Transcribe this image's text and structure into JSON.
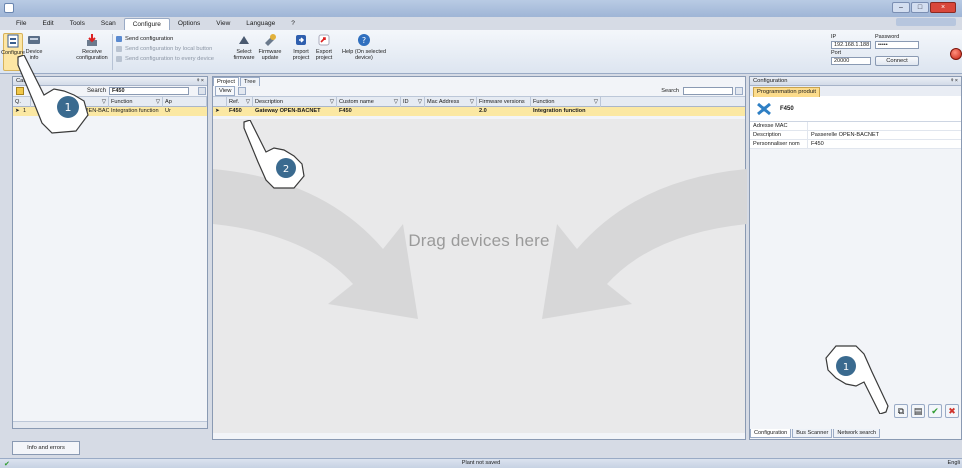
{
  "menu": [
    "File",
    "Edit",
    "Tools",
    "Scan",
    "Configure",
    "Options",
    "View",
    "Language",
    "?"
  ],
  "menu_active_index": 4,
  "ribbon": {
    "buttons": [
      {
        "label": "Configure",
        "icon": "configure-icon"
      },
      {
        "label": "Device info",
        "icon": "device-info-icon"
      },
      {
        "label": "Receive configuration",
        "icon": "receive-config-icon"
      },
      {
        "label": "Select firmware",
        "icon": "select-firmware-icon"
      },
      {
        "label": "Firmware update",
        "icon": "firmware-update-icon"
      },
      {
        "label": "Import project",
        "icon": "import-project-icon"
      },
      {
        "label": "Export project",
        "icon": "export-project-icon"
      },
      {
        "label": "Help (On selected device)",
        "icon": "help-icon"
      }
    ],
    "send": [
      "Send configuration",
      "Send configuration by local button",
      "Send configuration to every device"
    ]
  },
  "connection": {
    "ip_label": "IP",
    "ip": "192.168.1.188",
    "password_label": "Password",
    "password": "•••••",
    "port_label": "Port",
    "port": "20000",
    "connect": "Connect"
  },
  "catalog": {
    "title": "Catal",
    "search_label": "Search",
    "search_value": "F450",
    "columns": [
      "Q.",
      "",
      "cription",
      "Function",
      "Ap"
    ],
    "row": {
      "qty": "1",
      "description": "iteway OPEN-BACNET",
      "function": "Integration function",
      "app": "Ur"
    }
  },
  "info_tab": "Info and errors",
  "project": {
    "tabs": [
      "Project",
      "Tree"
    ],
    "view": "View",
    "search_label": "Search",
    "columns": [
      "Ref.",
      "Description",
      "Custom name",
      "ID",
      "Mac Address",
      "Firmware versions",
      "Function"
    ],
    "row": {
      "ref": "F450",
      "description": "Gateway OPEN-BACNET",
      "custom_name": "F450",
      "id": "",
      "mac": "",
      "firmware": "2.0",
      "function": "Integration function"
    },
    "drop_text": "Drag devices here"
  },
  "config": {
    "title": "Configuration",
    "tab": "Programmation produit",
    "product": "F450",
    "props": [
      {
        "k": "Adresse MAC",
        "v": ""
      },
      {
        "k": "Description",
        "v": "Passerelle OPEN-BACNET"
      },
      {
        "k": "Personnaliser nom",
        "v": "F450"
      }
    ],
    "bottom_tabs": [
      "Configuration",
      "Bus Scanner",
      "Network search"
    ]
  },
  "callouts": [
    "1",
    "2",
    "1"
  ],
  "status": {
    "center": "Plant not saved",
    "right": "Engli"
  },
  "colors": {
    "selected_row": "#fbe8a3",
    "callout": "#3a6a8f",
    "accent": "#fcdc8c"
  }
}
